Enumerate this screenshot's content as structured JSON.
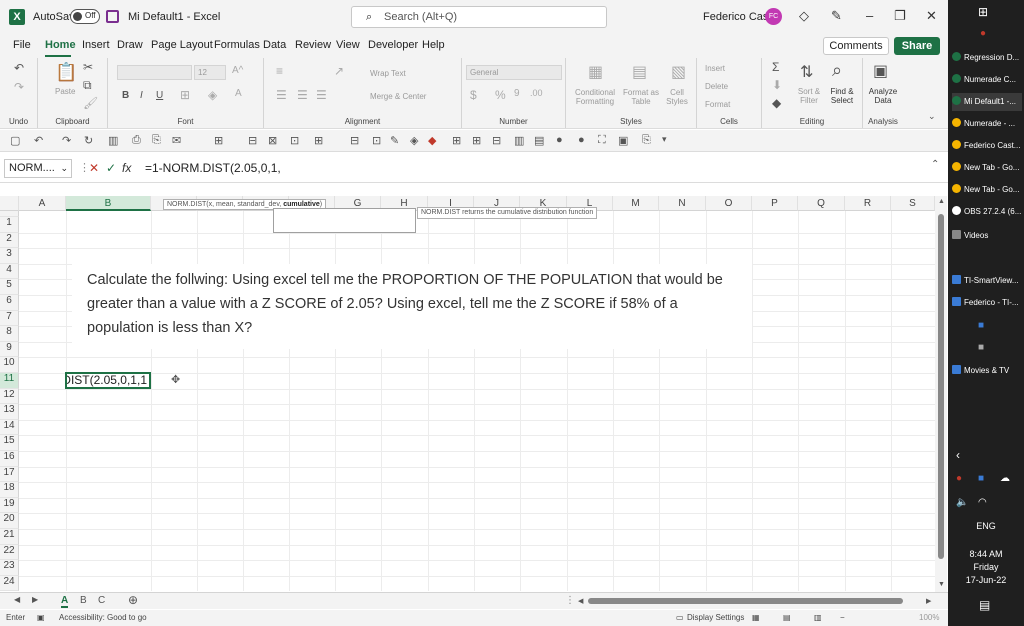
{
  "titlebar": {
    "autosave_label": "AutoSave",
    "autosave_state": "Off",
    "doc_title": "Mi Default1  -  Excel",
    "search_placeholder": "Search (Alt+Q)",
    "user_name": "Federico Castro",
    "user_initials": "FC"
  },
  "tabs": [
    "File",
    "Home",
    "Insert",
    "Draw",
    "Page Layout",
    "Formulas",
    "Data",
    "Review",
    "View",
    "Developer",
    "Help"
  ],
  "active_tab": "Home",
  "buttons": {
    "comments": "Comments",
    "share": "Share"
  },
  "ribbon": {
    "groups": [
      "Undo",
      "Clipboard",
      "Font",
      "Alignment",
      "Number",
      "Styles",
      "Cells",
      "Editing",
      "Analysis"
    ],
    "paste": "Paste",
    "font_size": "12",
    "wrap_text": "Wrap Text",
    "merge_center": "Merge & Center",
    "number_format": "General",
    "conditional_formatting": "Conditional Formatting",
    "format_as_table": "Format as Table",
    "cell_styles": "Cell Styles",
    "insert": "Insert",
    "delete": "Delete",
    "format": "Format",
    "sort_filter": "Sort & Filter",
    "find_select": "Find & Select",
    "analyze_data": "Analyze Data"
  },
  "formula_bar": {
    "name_box": "NORM....",
    "formula": "=1-NORM.DIST(2.05,0,1,"
  },
  "tooltips": {
    "function_signature_prefix": "NORM.DIST(x, mean, standard_dev, ",
    "function_signature_bold": "cumulative",
    "function_signature_suffix": ")",
    "description": "NORM.DIST returns the cumulative distribution function"
  },
  "columns": [
    "A",
    "B",
    "C",
    "D",
    "E",
    "F",
    "G",
    "H",
    "I",
    "J",
    "K",
    "L",
    "M",
    "N",
    "O",
    "P",
    "Q",
    "R",
    "S"
  ],
  "rows": [
    "1",
    "2",
    "3",
    "4",
    "5",
    "6",
    "7",
    "8",
    "9",
    "10",
    "11",
    "12",
    "13",
    "14",
    "15",
    "16",
    "17",
    "18",
    "19",
    "20",
    "21",
    "22",
    "23",
    "24"
  ],
  "question_text": "Calculate the follwing: Using excel tell me the PROPORTION OF THE POPULATION that would be greater than a value with a Z SCORE of 2.05? Using excel, tell me the Z SCORE if 58% of a population is less than X?",
  "active_cell_text": "DIST(2.05,0,1,1",
  "sheets": [
    "A",
    "B",
    "C"
  ],
  "active_sheet": "A",
  "status": {
    "mode": "Enter",
    "accessibility": "Accessibility: Good to go",
    "display_settings": "Display Settings",
    "zoom": "100%"
  },
  "taskbar": {
    "items": [
      "Regression D...",
      "Numerade C...",
      "Mi Default1 -...",
      "Numerade - ...",
      "Federico Cast...",
      "New Tab - Go...",
      "New Tab - Go...",
      "OBS 27.2.4 (6...",
      "Videos",
      "TI-SmartView...",
      "Federico - TI-...",
      "Movies & TV"
    ],
    "language": "ENG",
    "time": "8:44 AM",
    "day": "Friday",
    "date": "17-Jun-22"
  }
}
